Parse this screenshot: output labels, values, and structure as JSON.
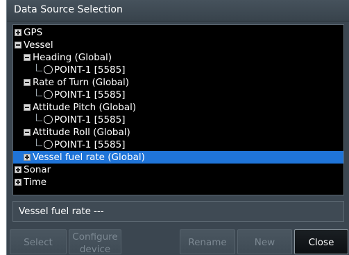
{
  "dialog": {
    "title": "Data Source Selection"
  },
  "tree": {
    "items": [
      {
        "label": "GPS",
        "expander": "plus",
        "kind": "branch",
        "selected": false
      },
      {
        "label": "Vessel",
        "expander": "minus",
        "kind": "branch",
        "selected": false
      },
      {
        "label": "Heading (Global)",
        "expander": "minus",
        "kind": "branch",
        "selected": false
      },
      {
        "label": "POINT-1 [5585]",
        "kind": "source",
        "selected": false
      },
      {
        "label": "Rate of Turn (Global)",
        "expander": "minus",
        "kind": "branch",
        "selected": false
      },
      {
        "label": "POINT-1 [5585]",
        "kind": "source",
        "selected": false
      },
      {
        "label": "Attitude Pitch (Global)",
        "expander": "minus",
        "kind": "branch",
        "selected": false
      },
      {
        "label": "POINT-1 [5585]",
        "kind": "source",
        "selected": false
      },
      {
        "label": "Attitude Roll (Global)",
        "expander": "minus",
        "kind": "branch",
        "selected": false
      },
      {
        "label": "POINT-1 [5585]",
        "kind": "source",
        "selected": false
      },
      {
        "label": "Vessel fuel rate (Global)",
        "expander": "plus",
        "kind": "branch",
        "selected": true
      },
      {
        "label": "Sonar",
        "expander": "plus",
        "kind": "branch",
        "selected": false
      },
      {
        "label": "Time",
        "expander": "plus",
        "kind": "branch",
        "selected": false
      }
    ]
  },
  "info": {
    "label": "Vessel fuel rate",
    "value": "---"
  },
  "buttons": {
    "select": "Select",
    "configure_line1": "Configure",
    "configure_line2": "device",
    "rename": "Rename",
    "new": "New",
    "close": "Close"
  },
  "colors": {
    "dialog_bg": "#3b4650",
    "tree_bg": "#000000",
    "selection": "#1f74d8",
    "disabled_text": "#7c8892"
  }
}
